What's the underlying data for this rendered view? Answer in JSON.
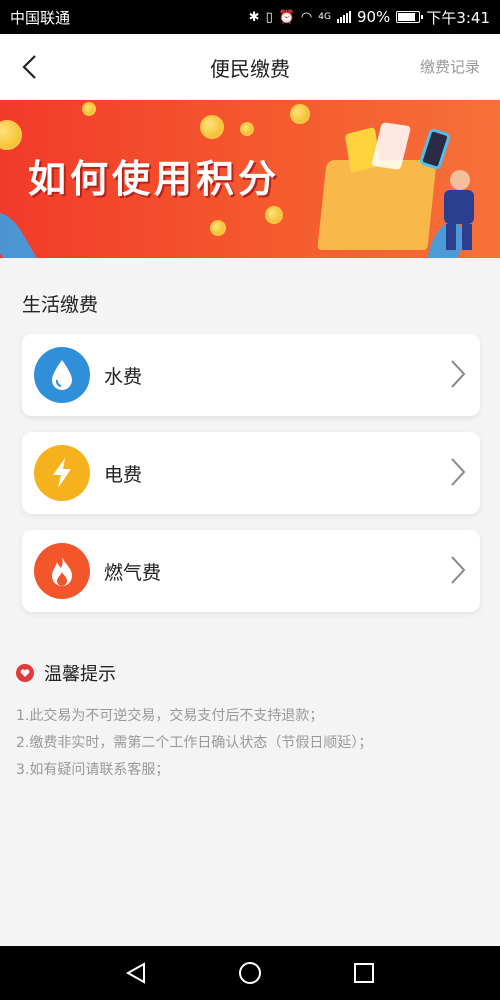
{
  "status_bar": {
    "carrier": "中国联通",
    "network": "4G",
    "battery": "90%",
    "battery_level": 0.9,
    "time": "下午3:41"
  },
  "header": {
    "title": "便民缴费",
    "record_link": "缴费记录"
  },
  "banner": {
    "title": "如何使用积分"
  },
  "section": {
    "title": "生活缴费",
    "items": [
      {
        "label": "水费",
        "icon": "water-drop-icon",
        "color": "#2f8fd8"
      },
      {
        "label": "电费",
        "icon": "lightning-icon",
        "color": "#f5b21c"
      },
      {
        "label": "燃气费",
        "icon": "flame-icon",
        "color": "#f2562a"
      }
    ]
  },
  "tips": {
    "title": "温馨提示",
    "lines": [
      "1.此交易为不可逆交易，交易支付后不支持退款；",
      "2.缴费非实时，需第二个工作日确认状态（节假日顺延）；",
      "3.如有疑问请联系客服；"
    ]
  },
  "colors": {
    "banner": "#f23a2a",
    "tips_icon": "#e23a3a",
    "text_primary": "#222222",
    "text_secondary": "#999999"
  }
}
